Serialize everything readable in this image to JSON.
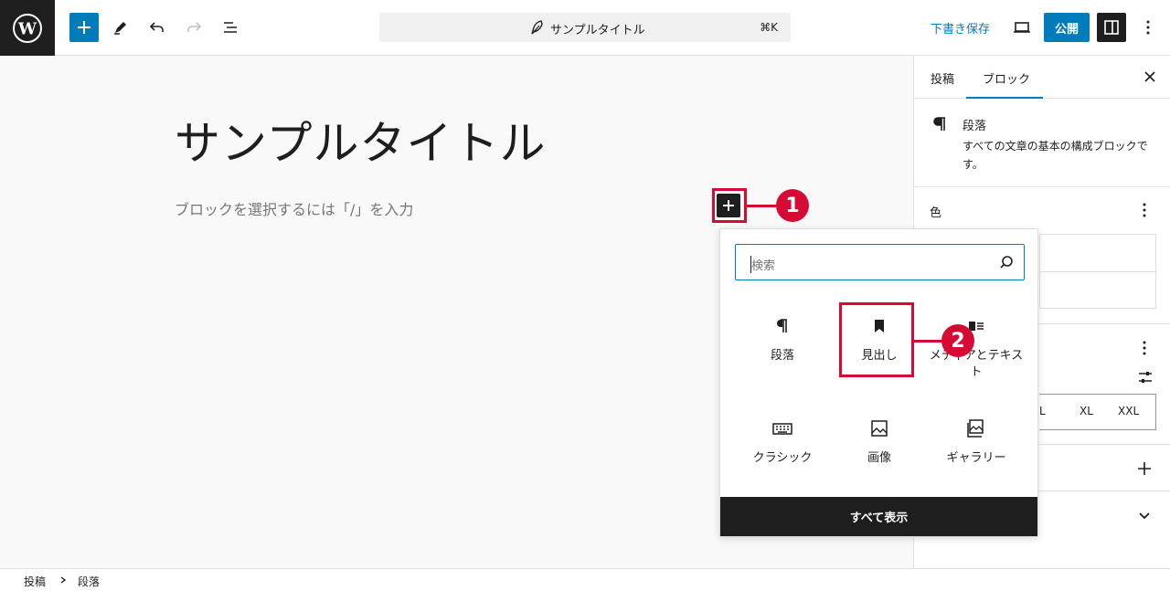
{
  "topbar": {
    "command_title": "サンプルタイトル",
    "command_shortcut": "⌘K",
    "save_draft": "下書き保存",
    "publish": "公開"
  },
  "canvas": {
    "post_title": "サンプルタイトル",
    "placeholder": "ブロックを選択するには「/」を入力"
  },
  "annotations": {
    "badge1": "1",
    "badge2": "2"
  },
  "inserter": {
    "search_placeholder": "検索",
    "blocks": [
      {
        "label": "段落",
        "icon": "paragraph-icon"
      },
      {
        "label": "見出し",
        "icon": "bookmark-heading-icon"
      },
      {
        "label": "メディアとテキスト",
        "icon": "media-text-icon"
      },
      {
        "label": "クラシック",
        "icon": "keyboard-icon"
      },
      {
        "label": "画像",
        "icon": "image-icon"
      },
      {
        "label": "ギャラリー",
        "icon": "gallery-icon"
      }
    ],
    "show_all": "すべて表示"
  },
  "sidebar": {
    "tabs": [
      "投稿",
      "ブロック"
    ],
    "block_title": "段落",
    "block_description": "すべての文章の基本の構成ブロックです。",
    "color_label": "色",
    "size_options": [
      "L",
      "XL",
      "XXL"
    ]
  },
  "footer": {
    "breadcrumbs": [
      "投稿",
      "段落"
    ]
  },
  "colors": {
    "accent": "#007cba",
    "highlight": "#d60a33",
    "dark": "#1e1e1e"
  }
}
